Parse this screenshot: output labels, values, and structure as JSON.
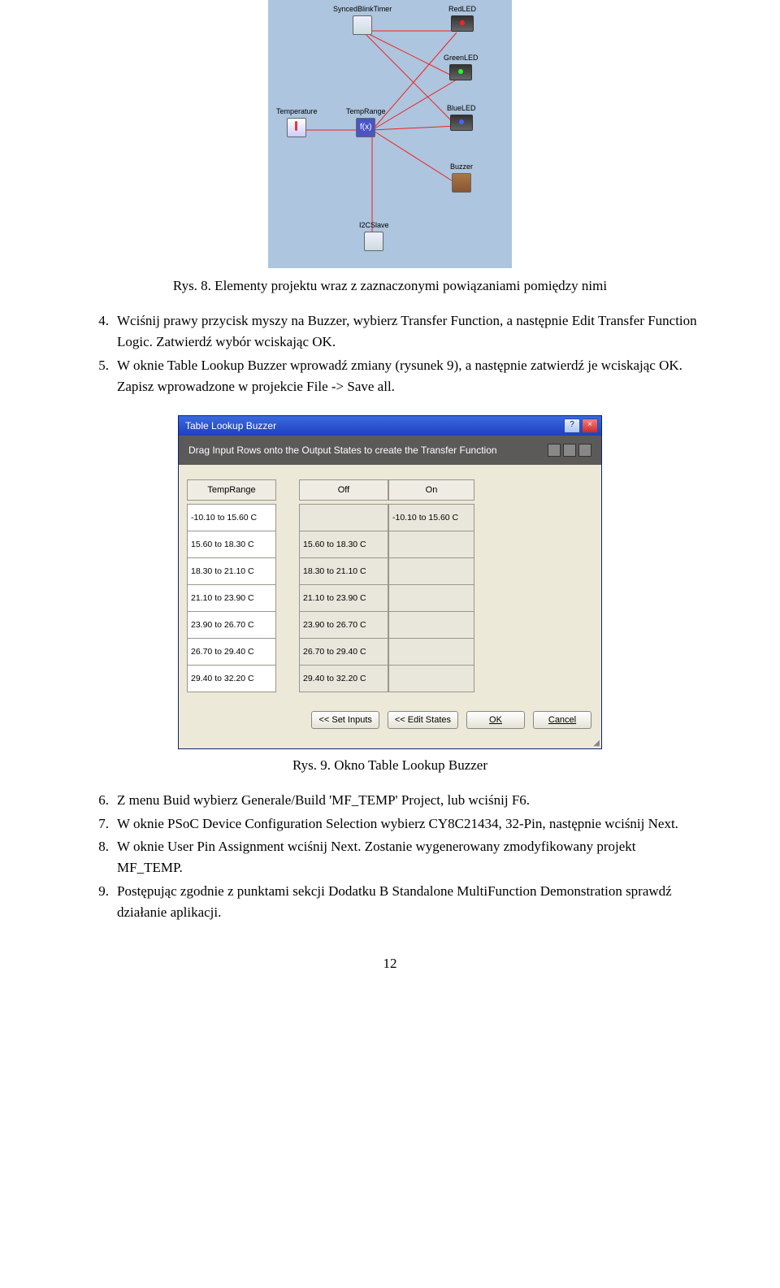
{
  "fig1": {
    "nodes": {
      "syncedBlinkTimer": "SyncedBlinkTimer",
      "redLED": "RedLED",
      "greenLED": "GreenLED",
      "temperature": "Temperature",
      "tempRange": "TempRange",
      "blueLED": "BlueLED",
      "buzzer": "Buzzer",
      "i2cSlave": "I2CSlave"
    },
    "caption": "Rys. 8. Elementy projektu wraz z zaznaczonymi powiązaniami pomiędzy nimi"
  },
  "steps_a": [
    {
      "n": "4.",
      "t": "Wciśnij prawy przycisk myszy na Buzzer, wybierz Transfer Function, a następnie Edit Transfer Function Logic. Zatwierdź wybór wciskając OK."
    },
    {
      "n": "5.",
      "t": "W oknie Table Lookup Buzzer wprowadź zmiany (rysunek 9), a następnie zatwierdź je wciskając OK. Zapisz wprowadzone w projekcie File -> Save all."
    }
  ],
  "dialog": {
    "title": "Table Lookup Buzzer",
    "instruction": "Drag Input Rows onto the Output States to create the Transfer Function",
    "headers": {
      "tempRange": "TempRange",
      "off": "Off",
      "on": "On"
    },
    "rows_temp": [
      "-10.10 to 15.60 C",
      "15.60 to 18.30 C",
      "18.30 to 21.10 C",
      "21.10 to 23.90 C",
      "23.90 to 26.70 C",
      "26.70 to 29.40 C",
      "29.40 to 32.20 C"
    ],
    "rows_off": [
      "",
      "15.60 to 18.30 C",
      "18.30 to 21.10 C",
      "21.10 to 23.90 C",
      "23.90 to 26.70 C",
      "26.70 to 29.40 C",
      "29.40 to 32.20 C"
    ],
    "rows_on": [
      "-10.10 to 15.60 C",
      "",
      "",
      "",
      "",
      "",
      ""
    ],
    "buttons": {
      "setInputs": "<< Set Inputs",
      "editStates": "<< Edit States",
      "ok": "OK",
      "cancel": "Cancel"
    }
  },
  "fig2_caption": "Rys. 9. Okno Table Lookup Buzzer",
  "steps_b": [
    {
      "n": "6.",
      "t": "Z menu Buid wybierz Generale/Build 'MF_TEMP' Project, lub wciśnij F6."
    },
    {
      "n": "7.",
      "t": "W oknie PSoC Device Configuration Selection wybierz CY8C21434, 32-Pin, następnie wciśnij Next."
    },
    {
      "n": "8.",
      "t": "W oknie User Pin Assignment wciśnij Next. Zostanie wygenerowany zmodyfikowany projekt MF_TEMP."
    },
    {
      "n": "9.",
      "t": "Postępując zgodnie z punktami sekcji Dodatku B Standalone MultiFunction Demonstration sprawdź działanie aplikacji."
    }
  ],
  "pagenum": "12"
}
